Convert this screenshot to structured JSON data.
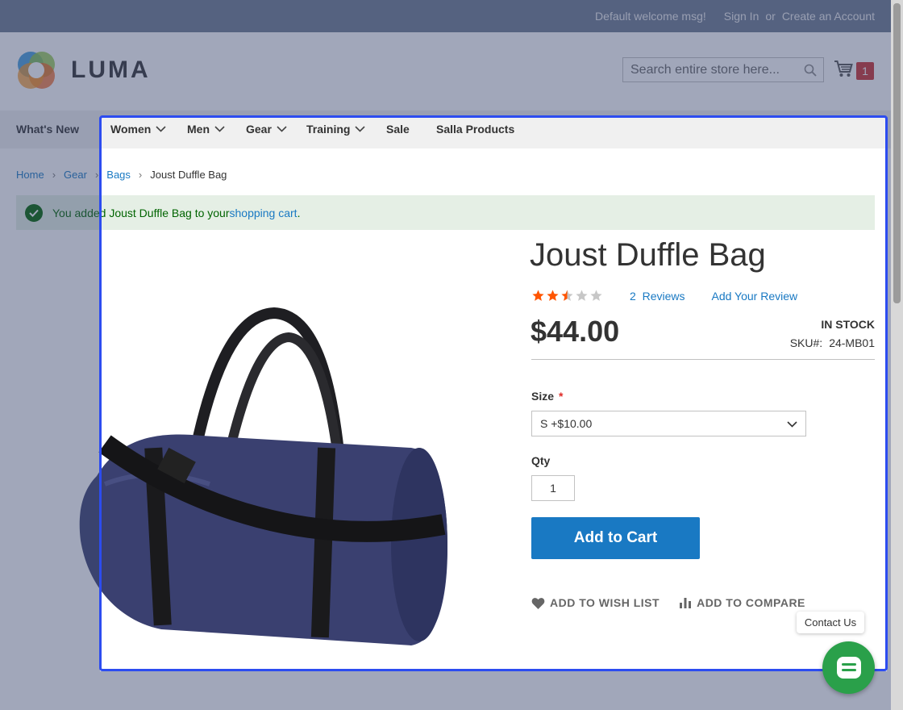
{
  "topbar": {
    "welcome": "Default welcome msg!",
    "sign_in": "Sign In",
    "or": "or",
    "create_account": "Create an Account"
  },
  "header": {
    "logo_text": "LUMA",
    "search_placeholder": "Search entire store here...",
    "cart_count": "1"
  },
  "nav": {
    "items": [
      {
        "label": "What's New"
      },
      {
        "label": "Women"
      },
      {
        "label": "Men"
      },
      {
        "label": "Gear"
      },
      {
        "label": "Training"
      },
      {
        "label": "Sale"
      },
      {
        "label": "Salla Products"
      }
    ]
  },
  "breadcrumbs": [
    "Home",
    "Gear",
    "Bags",
    "Joust Duffle Bag"
  ],
  "message": {
    "prefix": "You added Joust Duffle Bag to your ",
    "link": "shopping cart",
    "suffix": "."
  },
  "product": {
    "name": "Joust Duffle Bag",
    "rating_stars": 2.5,
    "rating_max": 5,
    "reviews_count": "2",
    "reviews_label": "Reviews",
    "add_review": "Add Your Review",
    "price": "$44.00",
    "stock": "In stock",
    "sku_label": "SKU#:",
    "sku": "24-MB01",
    "size_label": "Size",
    "required_mark": "*",
    "size_selected": "S +$10.00",
    "qty_label": "Qty",
    "qty_value": "1",
    "add_to_cart": "Add to Cart",
    "wishlist": "Add to Wish List",
    "compare": "Add to Compare"
  },
  "widget": {
    "contact_label": "Contact Us"
  },
  "colors": {
    "accent": "#1979c3",
    "star": "#ff5501",
    "highlight": "#2c4cf0",
    "chat": "#2aa04a"
  }
}
